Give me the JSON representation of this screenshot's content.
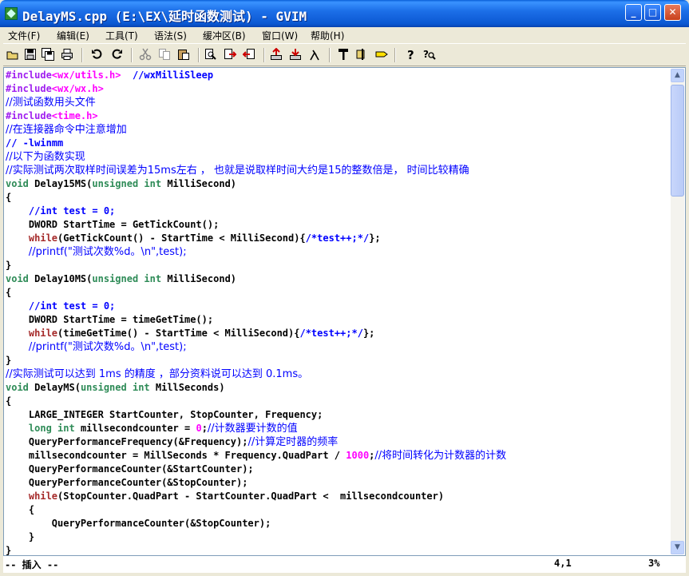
{
  "window": {
    "title": "DelayMS.cpp (E:\\EX\\延时函数测试) - GVIM"
  },
  "menu": [
    "文件(F)",
    "编辑(E)",
    "工具(T)",
    "语法(S)",
    "缓冲区(B)",
    "窗口(W)",
    "帮助(H)"
  ],
  "toolbar_icons": [
    "open-icon",
    "save-icon",
    "save-all-icon",
    "print-icon",
    "undo-icon",
    "redo-icon",
    "cut-icon",
    "copy-icon",
    "paste-icon",
    "find-replace-icon",
    "find-next-icon",
    "find-prev-icon",
    "load-session-icon",
    "save-session-icon",
    "run-script-icon",
    "make-icon",
    "build-tags-icon",
    "jump-tag-icon",
    "help-icon",
    "find-help-icon"
  ],
  "code": [
    [
      [
        "pp",
        "#include"
      ],
      [
        "str",
        "<wx/utils.h>"
      ],
      [
        "",
        "  "
      ],
      [
        "cm",
        "//wxMilliSleep"
      ]
    ],
    [
      [
        "pp",
        "#include"
      ],
      [
        "str",
        "<wx/wx.h>"
      ]
    ],
    [
      [
        "cm",
        "//测试函数用头文件"
      ]
    ],
    [
      [
        "pp",
        "#include"
      ],
      [
        "str",
        "<time.h>"
      ]
    ],
    [
      [
        "cm",
        "//在连接器命令中注意增加"
      ]
    ],
    [
      [
        "cm",
        "// -lwinmm"
      ]
    ],
    [
      [
        "cm",
        "//以下为函数实现"
      ]
    ],
    [
      [
        "cm",
        "//实际测试两次取样时间误差为15ms左右 ， 也就是说取样时间大约是15的整数倍是， 时间比较精确"
      ]
    ],
    [
      [
        "ty",
        "void"
      ],
      [
        "",
        " Delay15MS("
      ],
      [
        "ty",
        "unsigned"
      ],
      [
        "",
        " "
      ],
      [
        "ty",
        "int"
      ],
      [
        "",
        " MilliSecond)"
      ]
    ],
    [
      [
        "",
        "{"
      ]
    ],
    [
      [
        "",
        "    "
      ],
      [
        "cm",
        "//int test = 0;"
      ]
    ],
    [
      [
        "",
        "    DWORD StartTime = GetTickCount();"
      ]
    ],
    [
      [
        "",
        "    "
      ],
      [
        "kw",
        "while"
      ],
      [
        "",
        "(GetTickCount() - StartTime < MilliSecond){"
      ],
      [
        "cm",
        "/*test++;*/"
      ],
      [
        "",
        "};"
      ]
    ],
    [
      [
        "",
        "    "
      ],
      [
        "cm",
        "//printf(\"测试次数%d。\\n\",test);"
      ]
    ],
    [
      [
        "",
        "}"
      ]
    ],
    [
      [
        "ty",
        "void"
      ],
      [
        "",
        " Delay10MS("
      ],
      [
        "ty",
        "unsigned"
      ],
      [
        "",
        " "
      ],
      [
        "ty",
        "int"
      ],
      [
        "",
        " MilliSecond)"
      ]
    ],
    [
      [
        "",
        "{"
      ]
    ],
    [
      [
        "",
        "    "
      ],
      [
        "cm",
        "//int test = 0;"
      ]
    ],
    [
      [
        "",
        "    DWORD StartTime = timeGetTime();"
      ]
    ],
    [
      [
        "",
        "    "
      ],
      [
        "kw",
        "while"
      ],
      [
        "",
        "(timeGetTime() - StartTime < MilliSecond){"
      ],
      [
        "cm",
        "/*test++;*/"
      ],
      [
        "",
        "};"
      ]
    ],
    [
      [
        "",
        "    "
      ],
      [
        "cm",
        "//printf(\"测试次数%d。\\n\",test);"
      ]
    ],
    [
      [
        "",
        "}"
      ]
    ],
    [
      [
        "cm",
        "//实际测试可以达到 1ms 的精度 ，部分资料说可以达到 0.1ms。"
      ]
    ],
    [
      [
        "ty",
        "void"
      ],
      [
        "",
        " DelayMS("
      ],
      [
        "ty",
        "unsigned"
      ],
      [
        "",
        " "
      ],
      [
        "ty",
        "int"
      ],
      [
        "",
        " MillSeconds)"
      ]
    ],
    [
      [
        "",
        "{"
      ]
    ],
    [
      [
        "",
        "    LARGE_INTEGER StartCounter, StopCounter, Frequency;"
      ]
    ],
    [
      [
        "",
        "    "
      ],
      [
        "ty",
        "long"
      ],
      [
        "",
        " "
      ],
      [
        "ty",
        "int"
      ],
      [
        "",
        " millsecondcounter = "
      ],
      [
        "num",
        "0"
      ],
      [
        "",
        ";"
      ],
      [
        "cm",
        "//计数器要计数的值"
      ]
    ],
    [
      [
        "",
        "    QueryPerformanceFrequency(&Frequency);"
      ],
      [
        "cm",
        "//计算定时器的频率"
      ]
    ],
    [
      [
        "",
        "    millsecondcounter = MillSeconds * Frequency.QuadPart / "
      ],
      [
        "num",
        "1000"
      ],
      [
        "",
        ";"
      ],
      [
        "cm",
        "//将时间转化为计数器的计数"
      ]
    ],
    [
      [
        "",
        "    QueryPerformanceCounter(&StartCounter);"
      ]
    ],
    [
      [
        "",
        "    QueryPerformanceCounter(&StopCounter);"
      ]
    ],
    [
      [
        "",
        "    "
      ],
      [
        "kw",
        "while"
      ],
      [
        "",
        "(StopCounter.QuadPart - StartCounter.QuadPart <  millsecondcounter)"
      ]
    ],
    [
      [
        "",
        "    {"
      ]
    ],
    [
      [
        "",
        "        QueryPerformanceCounter(&StopCounter);"
      ]
    ],
    [
      [
        "",
        "    }"
      ]
    ],
    [
      [
        "",
        "}"
      ]
    ]
  ],
  "status": {
    "mode": "-- 插入 --",
    "position": "4,1",
    "percent": "3%"
  }
}
